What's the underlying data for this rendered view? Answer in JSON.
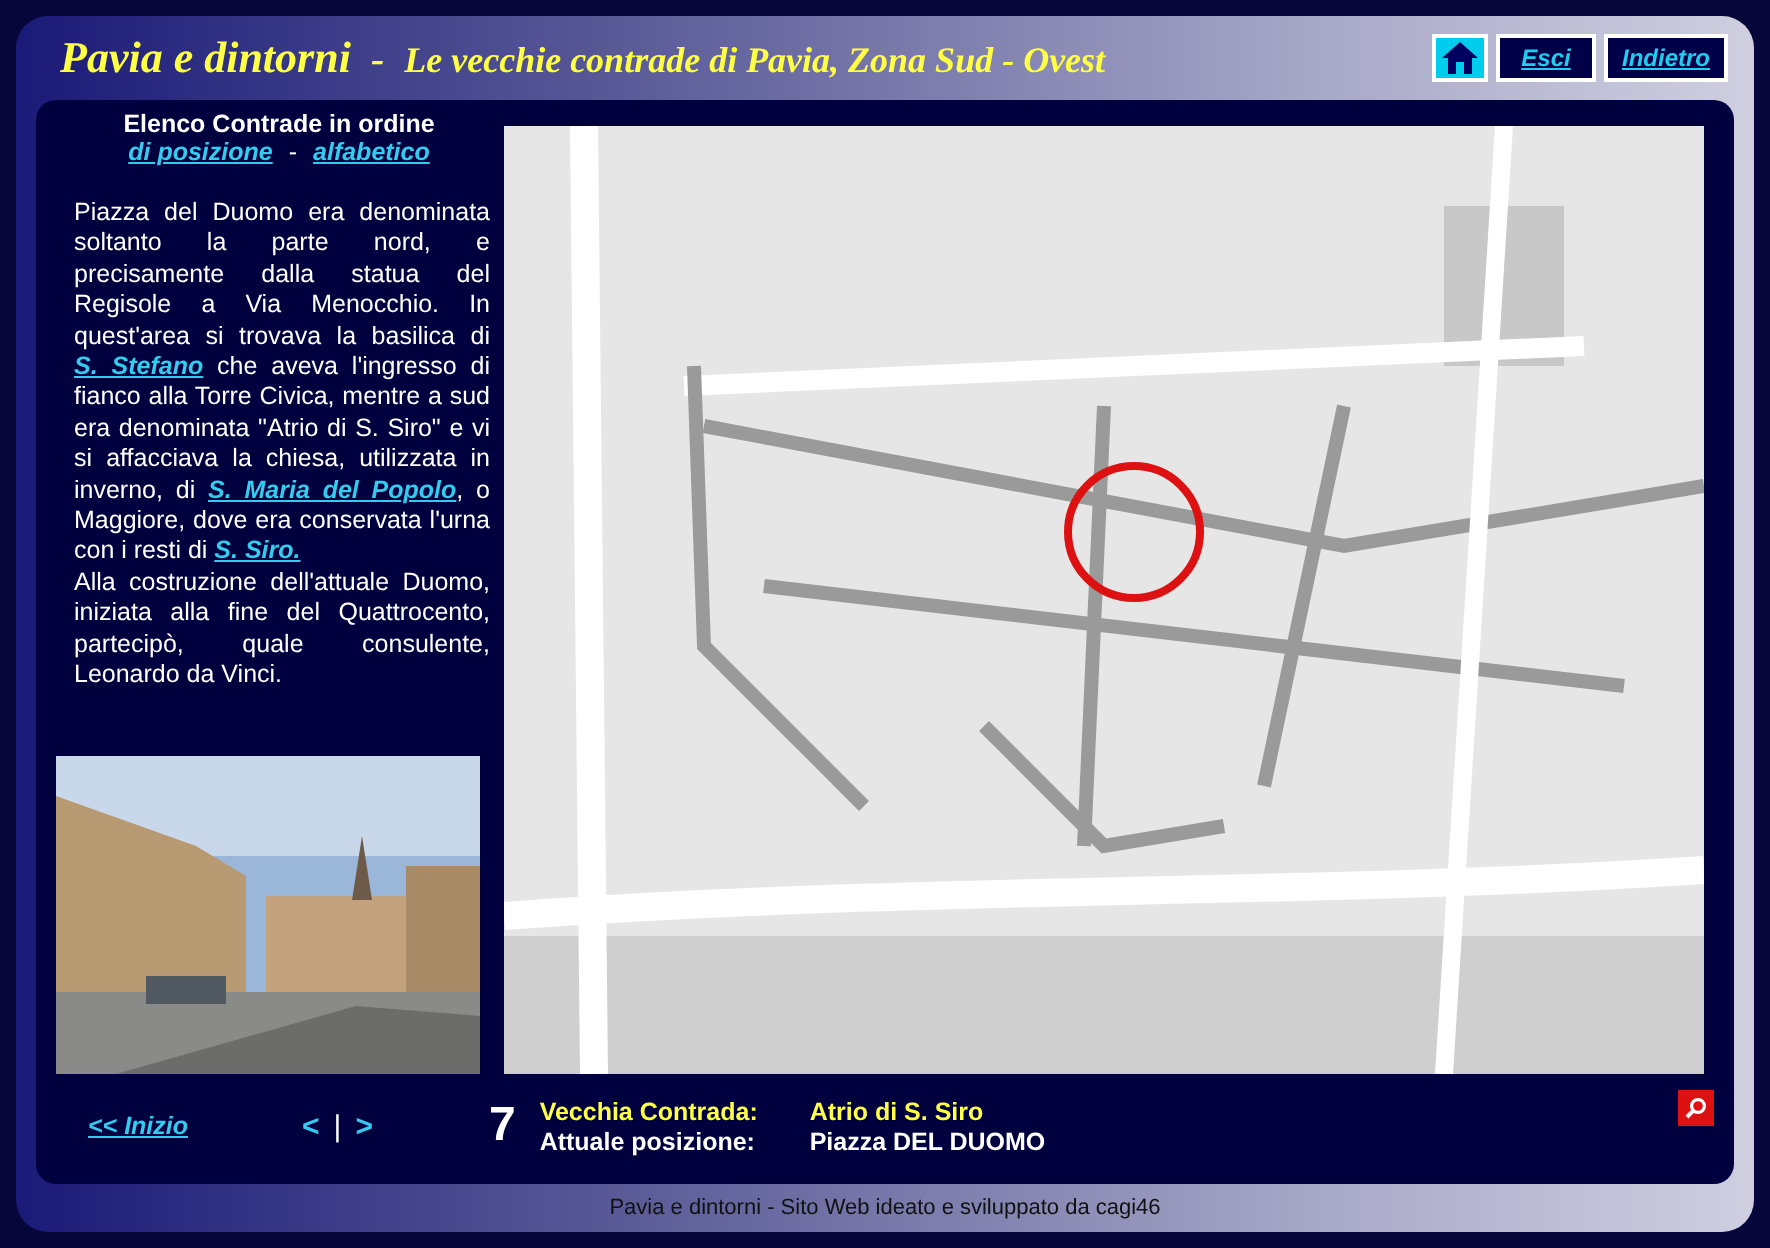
{
  "header": {
    "title": "Pavia e dintorni",
    "separator": "-",
    "subtitle": "Le vecchie contrade di Pavia,  Zona Sud - Ovest",
    "buttons": [
      {
        "kind": "home"
      },
      {
        "kind": "text",
        "label": "Esci"
      },
      {
        "kind": "text",
        "label": "Indietro"
      }
    ]
  },
  "sidebar": {
    "heading": "Elenco Contrade in ordine",
    "order_links": [
      {
        "label": "di posizione"
      },
      {
        "label": "alfabetico"
      }
    ],
    "order_separator": "-",
    "paragraphs": [
      [
        {
          "kind": "text",
          "text": "Piazza del Duomo era denominata soltanto la parte nord, e precisamente dalla statua del Regisole a Via Menocchio. In quest'area si trovava la basilica di "
        },
        {
          "kind": "link",
          "text": "S. Stefano"
        },
        {
          "kind": "text",
          "text": " che aveva l'ingresso di fianco alla Torre Civica, mentre a sud era denominata \"Atrio di S. Siro\" e vi si affacciava la chiesa, utilizzata in inverno, di "
        },
        {
          "kind": "link",
          "text": "S. Maria del Popolo"
        },
        {
          "kind": "text",
          "text": ", o Maggiore, dove era conservata l'urna con i resti di "
        },
        {
          "kind": "link",
          "text": "S. Siro."
        }
      ],
      [
        {
          "kind": "text",
          "text": "Alla costruzione dell'attuale Duomo, iniziata alla fine del Quattrocento, partecipò, quale consulente, Leonardo da Vinci."
        }
      ]
    ],
    "photo": {
      "kind": "picture"
    }
  },
  "map": {
    "kind": "picture"
  },
  "bottom_bar": {
    "home_link": "<< Inizio",
    "prev": "<",
    "divider": "|",
    "next": ">",
    "number": "7",
    "fields": [
      {
        "label": "Vecchia Contrada:",
        "value": "Atrio di S. Siro",
        "highlight": true
      },
      {
        "label": "Attuale posizione:",
        "value": "Piazza DEL DUOMO",
        "highlight": false
      }
    ]
  },
  "footer": "Pavia e dintorni - Sito Web ideato e sviluppato da cagi46"
}
